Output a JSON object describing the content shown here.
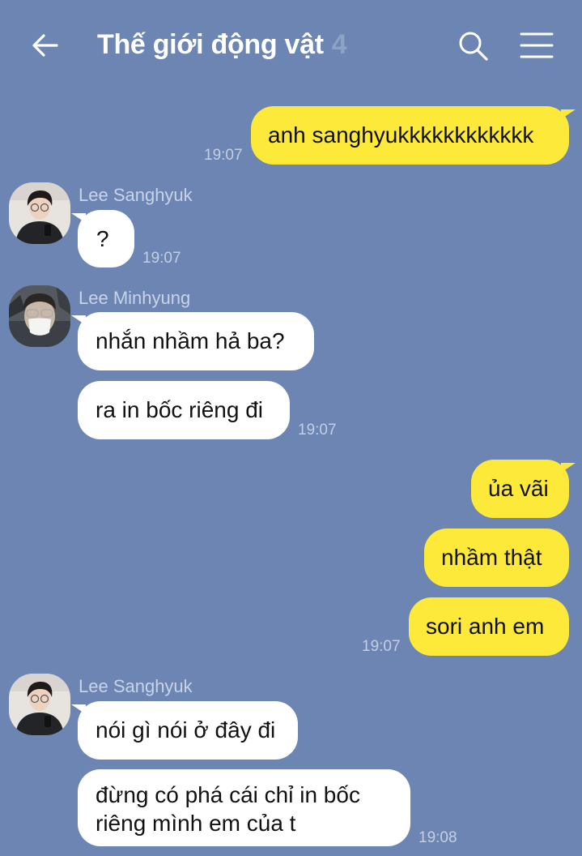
{
  "header": {
    "title": "Thế giới động vật",
    "member_count": "4",
    "back_icon": "arrow-left-icon",
    "search_icon": "search-icon",
    "menu_icon": "hamburger-menu-icon"
  },
  "colors": {
    "background": "#6c85b3",
    "my_bubble": "#fde93a",
    "their_bubble": "#ffffff"
  },
  "messages": {
    "m1": {
      "text": "anh sanghyukkkkkkkkkkkk",
      "time": "19:07"
    },
    "g1": {
      "sender": "Lee Sanghyuk",
      "m2": {
        "text": "?",
        "time": "19:07"
      }
    },
    "g2": {
      "sender": "Lee Minhyung",
      "m3": {
        "text": "nhắn nhầm hả ba?"
      },
      "m4": {
        "text": "ra in bốc riêng đi",
        "time": "19:07"
      }
    },
    "m5": {
      "text": "ủa vãi"
    },
    "m6": {
      "text": "nhầm thật"
    },
    "m7": {
      "text": "sori anh em",
      "time": "19:07"
    },
    "g3": {
      "sender": "Lee Sanghyuk",
      "m8": {
        "text": "nói gì nói ở đây đi"
      },
      "m9": {
        "line1": "đừng có phá cái chỉ in bốc",
        "line2": "riêng mình em của t",
        "time": "19:08"
      }
    }
  }
}
